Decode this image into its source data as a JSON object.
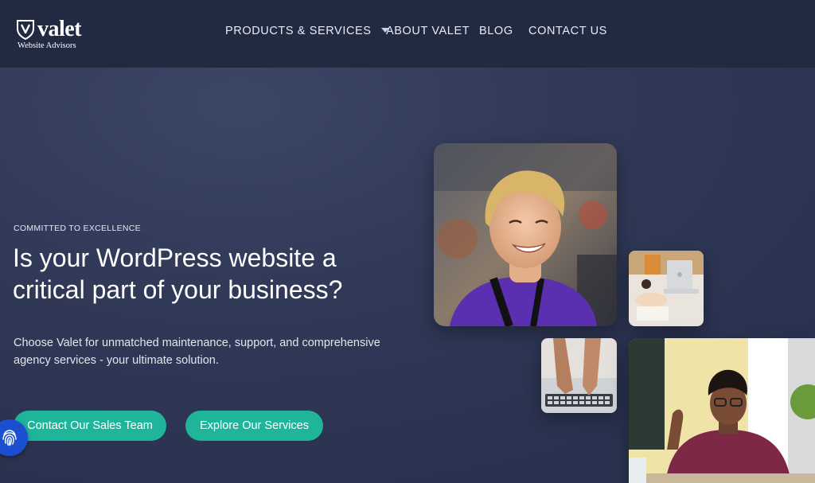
{
  "logo": {
    "brand": "valet",
    "tagline": "Website Advisors"
  },
  "nav": {
    "products": "PRODUCTS & SERVICES",
    "about": "ABOUT VALET",
    "blog": "BLOG",
    "contact": "CONTACT US"
  },
  "hero": {
    "eyebrow": "COMMITTED TO EXCELLENCE",
    "headline": "Is your WordPress website a critical part of your business?",
    "subtext": "Choose Valet for unmatched maintenance, support, and comprehensive agency services - your ultimate solution.",
    "cta_primary": "Contact Our Sales Team",
    "cta_secondary": "Explore Our Services"
  },
  "colors": {
    "header_bg": "#222a42",
    "page_bg": "#313a58",
    "accent": "#1fb59a",
    "fingerprint_button": "#1c4fd0"
  },
  "icons": {
    "logo": "shield-v-icon",
    "dropdown": "caret-down-icon",
    "accessibility": "fingerprint-icon"
  }
}
